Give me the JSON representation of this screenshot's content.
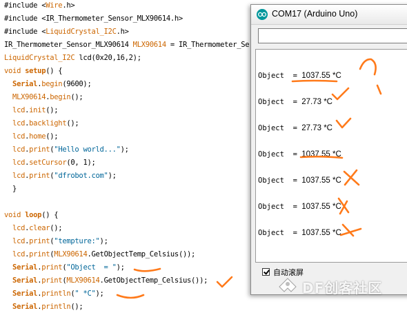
{
  "editor": {
    "lines": [
      {
        "parts": [
          {
            "t": "#include <",
            "c": "blk"
          },
          {
            "t": "Wire",
            "c": "lib"
          },
          {
            "t": ".h>",
            "c": "blk"
          }
        ]
      },
      {
        "parts": [
          {
            "t": "#include <IR_Thermometer_Sensor_MLX90614.h>",
            "c": "blk"
          }
        ]
      },
      {
        "parts": [
          {
            "t": "#include <",
            "c": "blk"
          },
          {
            "t": "LiquidCrystal_I2C",
            "c": "lib"
          },
          {
            "t": ".h>",
            "c": "blk"
          }
        ]
      },
      {
        "parts": [
          {
            "t": "IR_Thermometer_Sensor_MLX90614 ",
            "c": "blk"
          },
          {
            "t": "MLX90614",
            "c": "kw"
          },
          {
            "t": " = IR_Thermometer_Ser",
            "c": "blk"
          }
        ]
      },
      {
        "parts": [
          {
            "t": "LiquidCrystal_I2C",
            "c": "kw"
          },
          {
            "t": " lcd(0x20,16,2);",
            "c": "blk"
          }
        ]
      },
      {
        "parts": [
          {
            "t": "void ",
            "c": "kw"
          },
          {
            "t": "setup",
            "c": "kwb"
          },
          {
            "t": "() {",
            "c": "blk"
          }
        ]
      },
      {
        "parts": [
          {
            "t": "  ",
            "c": "blk"
          },
          {
            "t": "Serial",
            "c": "kwb"
          },
          {
            "t": ".",
            "c": "blk"
          },
          {
            "t": "begin",
            "c": "kw"
          },
          {
            "t": "(9600);",
            "c": "blk"
          }
        ]
      },
      {
        "parts": [
          {
            "t": "  ",
            "c": "blk"
          },
          {
            "t": "MLX90614",
            "c": "kw"
          },
          {
            "t": ".",
            "c": "blk"
          },
          {
            "t": "begin",
            "c": "kw"
          },
          {
            "t": "();",
            "c": "blk"
          }
        ]
      },
      {
        "parts": [
          {
            "t": "  ",
            "c": "blk"
          },
          {
            "t": "lcd",
            "c": "kw"
          },
          {
            "t": ".",
            "c": "blk"
          },
          {
            "t": "init",
            "c": "kw"
          },
          {
            "t": "();",
            "c": "blk"
          }
        ]
      },
      {
        "parts": [
          {
            "t": "  ",
            "c": "blk"
          },
          {
            "t": "lcd",
            "c": "kw"
          },
          {
            "t": ".",
            "c": "blk"
          },
          {
            "t": "backlight",
            "c": "kw"
          },
          {
            "t": "();",
            "c": "blk"
          }
        ]
      },
      {
        "parts": [
          {
            "t": "  ",
            "c": "blk"
          },
          {
            "t": "lcd",
            "c": "kw"
          },
          {
            "t": ".",
            "c": "blk"
          },
          {
            "t": "home",
            "c": "kw"
          },
          {
            "t": "();",
            "c": "blk"
          }
        ]
      },
      {
        "parts": [
          {
            "t": "  ",
            "c": "blk"
          },
          {
            "t": "lcd",
            "c": "kw"
          },
          {
            "t": ".",
            "c": "blk"
          },
          {
            "t": "print",
            "c": "kw"
          },
          {
            "t": "(",
            "c": "blk"
          },
          {
            "t": "\"Hello world...\"",
            "c": "str"
          },
          {
            "t": ");",
            "c": "blk"
          }
        ]
      },
      {
        "parts": [
          {
            "t": "  ",
            "c": "blk"
          },
          {
            "t": "lcd",
            "c": "kw"
          },
          {
            "t": ".",
            "c": "blk"
          },
          {
            "t": "setCursor",
            "c": "kw"
          },
          {
            "t": "(0, 1);",
            "c": "blk"
          }
        ]
      },
      {
        "parts": [
          {
            "t": "  ",
            "c": "blk"
          },
          {
            "t": "lcd",
            "c": "kw"
          },
          {
            "t": ".",
            "c": "blk"
          },
          {
            "t": "print",
            "c": "kw"
          },
          {
            "t": "(",
            "c": "blk"
          },
          {
            "t": "\"dfrobot.com\"",
            "c": "str"
          },
          {
            "t": ");",
            "c": "blk"
          }
        ]
      },
      {
        "parts": [
          {
            "t": "  }",
            "c": "blk"
          }
        ]
      },
      {
        "parts": [
          {
            "t": "",
            "c": "blk"
          }
        ]
      },
      {
        "parts": [
          {
            "t": "void ",
            "c": "kw"
          },
          {
            "t": "loop",
            "c": "kwb"
          },
          {
            "t": "() {",
            "c": "blk"
          }
        ]
      },
      {
        "parts": [
          {
            "t": "  ",
            "c": "blk"
          },
          {
            "t": "lcd",
            "c": "kw"
          },
          {
            "t": ".",
            "c": "blk"
          },
          {
            "t": "clear",
            "c": "kw"
          },
          {
            "t": "();",
            "c": "blk"
          }
        ]
      },
      {
        "parts": [
          {
            "t": "  ",
            "c": "blk"
          },
          {
            "t": "lcd",
            "c": "kw"
          },
          {
            "t": ".",
            "c": "blk"
          },
          {
            "t": "print",
            "c": "kw"
          },
          {
            "t": "(",
            "c": "blk"
          },
          {
            "t": "\"tempture:\"",
            "c": "str"
          },
          {
            "t": ");",
            "c": "blk"
          }
        ]
      },
      {
        "parts": [
          {
            "t": "  ",
            "c": "blk"
          },
          {
            "t": "lcd",
            "c": "kw"
          },
          {
            "t": ".",
            "c": "blk"
          },
          {
            "t": "print",
            "c": "kw"
          },
          {
            "t": "(",
            "c": "blk"
          },
          {
            "t": "MLX90614",
            "c": "kw"
          },
          {
            "t": ".GetObjectTemp_Celsius());",
            "c": "blk"
          }
        ]
      },
      {
        "parts": [
          {
            "t": "  ",
            "c": "blk"
          },
          {
            "t": "Serial",
            "c": "kwb"
          },
          {
            "t": ".",
            "c": "blk"
          },
          {
            "t": "print",
            "c": "kw"
          },
          {
            "t": "(",
            "c": "blk"
          },
          {
            "t": "\"Object  = \"",
            "c": "str"
          },
          {
            "t": ");",
            "c": "blk"
          }
        ]
      },
      {
        "parts": [
          {
            "t": "  ",
            "c": "blk"
          },
          {
            "t": "Serial",
            "c": "kwb"
          },
          {
            "t": ".",
            "c": "blk"
          },
          {
            "t": "print",
            "c": "kw"
          },
          {
            "t": "(",
            "c": "blk"
          },
          {
            "t": "MLX90614",
            "c": "kw"
          },
          {
            "t": ".GetObjectTemp_Celsius());",
            "c": "blk"
          }
        ]
      },
      {
        "parts": [
          {
            "t": "  ",
            "c": "blk"
          },
          {
            "t": "Serial",
            "c": "kwb"
          },
          {
            "t": ".",
            "c": "blk"
          },
          {
            "t": "println",
            "c": "kw"
          },
          {
            "t": "(",
            "c": "blk"
          },
          {
            "t": "\" *C\"",
            "c": "str"
          },
          {
            "t": ");",
            "c": "blk"
          }
        ]
      },
      {
        "parts": [
          {
            "t": "  ",
            "c": "blk"
          },
          {
            "t": "Serial",
            "c": "kwb"
          },
          {
            "t": ".",
            "c": "blk"
          },
          {
            "t": "println",
            "c": "kw"
          },
          {
            "t": "();",
            "c": "blk"
          }
        ]
      }
    ]
  },
  "serial_monitor": {
    "title": "COM17 (Arduino Uno)",
    "send_value": "",
    "output": [
      {
        "label": "Object  = ",
        "value": "1037.55",
        "unit": " *C"
      },
      {
        "label": "Object  = ",
        "value": "27.73",
        "unit": " *C"
      },
      {
        "label": "Object  = ",
        "value": "27.73",
        "unit": " *C"
      },
      {
        "label": "Object  = ",
        "value": "1037.55",
        "unit": " *C"
      },
      {
        "label": "Object  = ",
        "value": "1037.55",
        "unit": " *C"
      },
      {
        "label": "Object  = ",
        "value": "1037.55",
        "unit": " *C"
      },
      {
        "label": "Object  = ",
        "value": "1037.55",
        "unit": " *C"
      }
    ],
    "autoscroll_label": "自动滚屏",
    "autoscroll_checked": true
  },
  "watermark": {
    "text": "DF创客社区"
  },
  "colors": {
    "annotation": "#ff7a1a",
    "arduino_teal": "#00979c"
  }
}
